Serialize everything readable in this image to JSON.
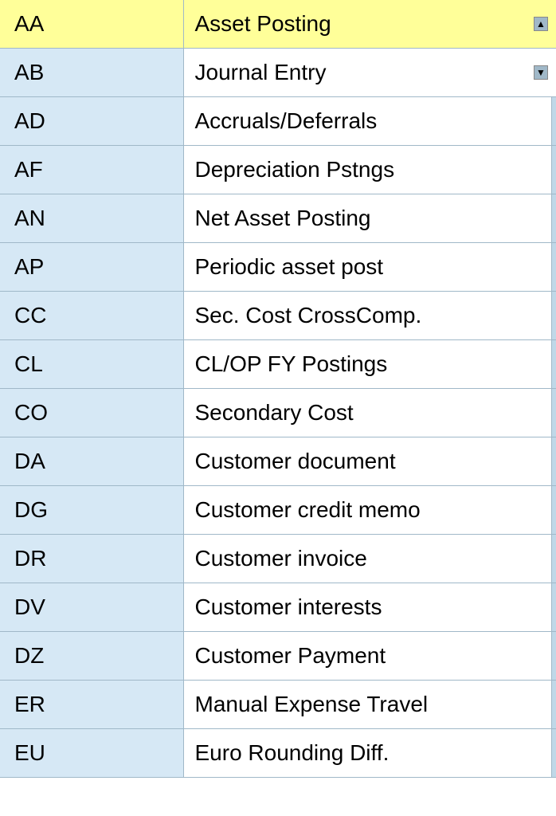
{
  "table": {
    "rows": [
      {
        "code": "AA",
        "description": "Asset Posting",
        "highlight": true,
        "show_scroll": true
      },
      {
        "code": "AB",
        "description": "Journal Entry",
        "highlight": false,
        "show_scroll": true
      },
      {
        "code": "AD",
        "description": "Accruals/Deferrals",
        "highlight": false,
        "show_scroll": false
      },
      {
        "code": "AF",
        "description": "Depreciation Pstngs",
        "highlight": false,
        "show_scroll": false
      },
      {
        "code": "AN",
        "description": "Net Asset Posting",
        "highlight": false,
        "show_scroll": false
      },
      {
        "code": "AP",
        "description": "Periodic asset post",
        "highlight": false,
        "show_scroll": false
      },
      {
        "code": "CC",
        "description": "Sec. Cost CrossComp.",
        "highlight": false,
        "show_scroll": false
      },
      {
        "code": "CL",
        "description": "CL/OP FY Postings",
        "highlight": false,
        "show_scroll": false
      },
      {
        "code": "CO",
        "description": "Secondary Cost",
        "highlight": false,
        "show_scroll": false
      },
      {
        "code": "DA",
        "description": "Customer document",
        "highlight": false,
        "show_scroll": false
      },
      {
        "code": "DG",
        "description": "Customer credit memo",
        "highlight": false,
        "show_scroll": false
      },
      {
        "code": "DR",
        "description": "Customer invoice",
        "highlight": false,
        "show_scroll": false
      },
      {
        "code": "DV",
        "description": "Customer interests",
        "highlight": false,
        "show_scroll": false
      },
      {
        "code": "DZ",
        "description": "Customer Payment",
        "highlight": false,
        "show_scroll": false
      },
      {
        "code": "ER",
        "description": "Manual Expense Travel",
        "highlight": false,
        "show_scroll": false
      },
      {
        "code": "EU",
        "description": "Euro Rounding Diff.",
        "highlight": false,
        "show_scroll": false
      }
    ]
  }
}
